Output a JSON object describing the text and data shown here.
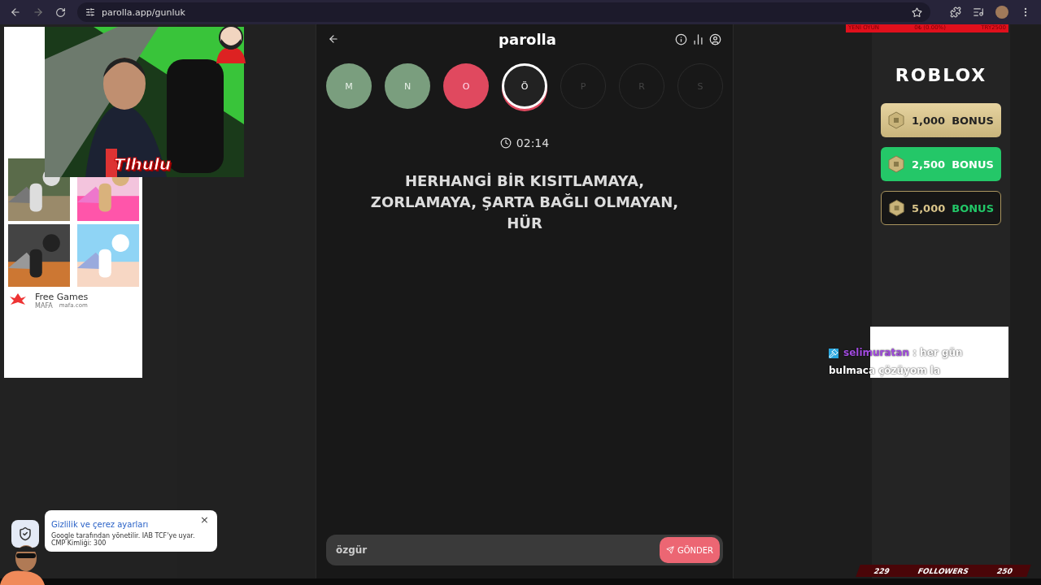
{
  "browser": {
    "url": "parolla.app/gunluk"
  },
  "game": {
    "title": "parolla",
    "letters": [
      {
        "letter": "M",
        "kind": "correct"
      },
      {
        "letter": "N",
        "kind": "correct"
      },
      {
        "letter": "O",
        "kind": "wrong"
      },
      {
        "letter": "Ö",
        "kind": "current"
      },
      {
        "letter": "P",
        "kind": "pending"
      },
      {
        "letter": "R",
        "kind": "pending"
      },
      {
        "letter": "S",
        "kind": "pending"
      }
    ],
    "timer": "02:14",
    "question_lines": [
      "HERHANGİ BİR KISITLAMAYA,",
      "ZORLAMAYA, ŞARTA BAĞLI OLMAYAN,",
      "HÜR"
    ],
    "answer": {
      "value": "özgür"
    },
    "submit_button": "GÖNDER"
  },
  "left_ad": {
    "title": "Free Games",
    "domain": "mafa.com",
    "brand": "MAFA"
  },
  "cookie_notice": {
    "title": "Gizlilik ve çerez ayarları",
    "text": "Google tarafından yönetilir. IAB TCF'ye uyar. CMP Kimliği: 300",
    "close": "×"
  },
  "right_ad": {
    "logo": "ROBLOX",
    "offers": [
      {
        "amount": "1,000",
        "word": "BONUS",
        "kind": "gold"
      },
      {
        "amount": "2,500",
        "word": "BONUS",
        "kind": "green"
      },
      {
        "amount": "5,000",
        "word": "BONUS",
        "kind": "dark"
      }
    ]
  },
  "stream_overlay": {
    "streamer_tag": "Tlhulu",
    "goal_bar": [
      "YENİ OYUN",
      "0₺ (0.00%)",
      "TRY2500"
    ],
    "chat": {
      "user": "selimuratan",
      "message": ": her gün bulmaca çözüyom la"
    },
    "followers": {
      "current": "229",
      "label": "FOLLOWERS",
      "goal": "250"
    }
  }
}
